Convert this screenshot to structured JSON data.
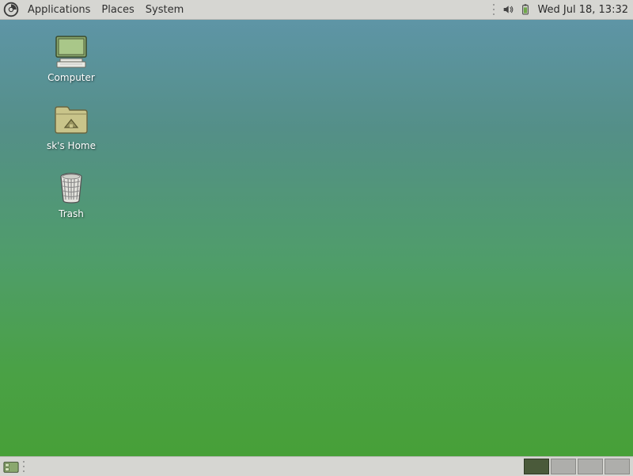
{
  "top_panel": {
    "menus": {
      "applications": "Applications",
      "places": "Places",
      "system": "System"
    },
    "clock": "Wed Jul 18, 13:32"
  },
  "desktop": {
    "icons": {
      "computer": "Computer",
      "home": "sk's Home",
      "trash": "Trash"
    }
  },
  "bottom_panel": {
    "workspaces": 4,
    "active_workspace": 1
  }
}
